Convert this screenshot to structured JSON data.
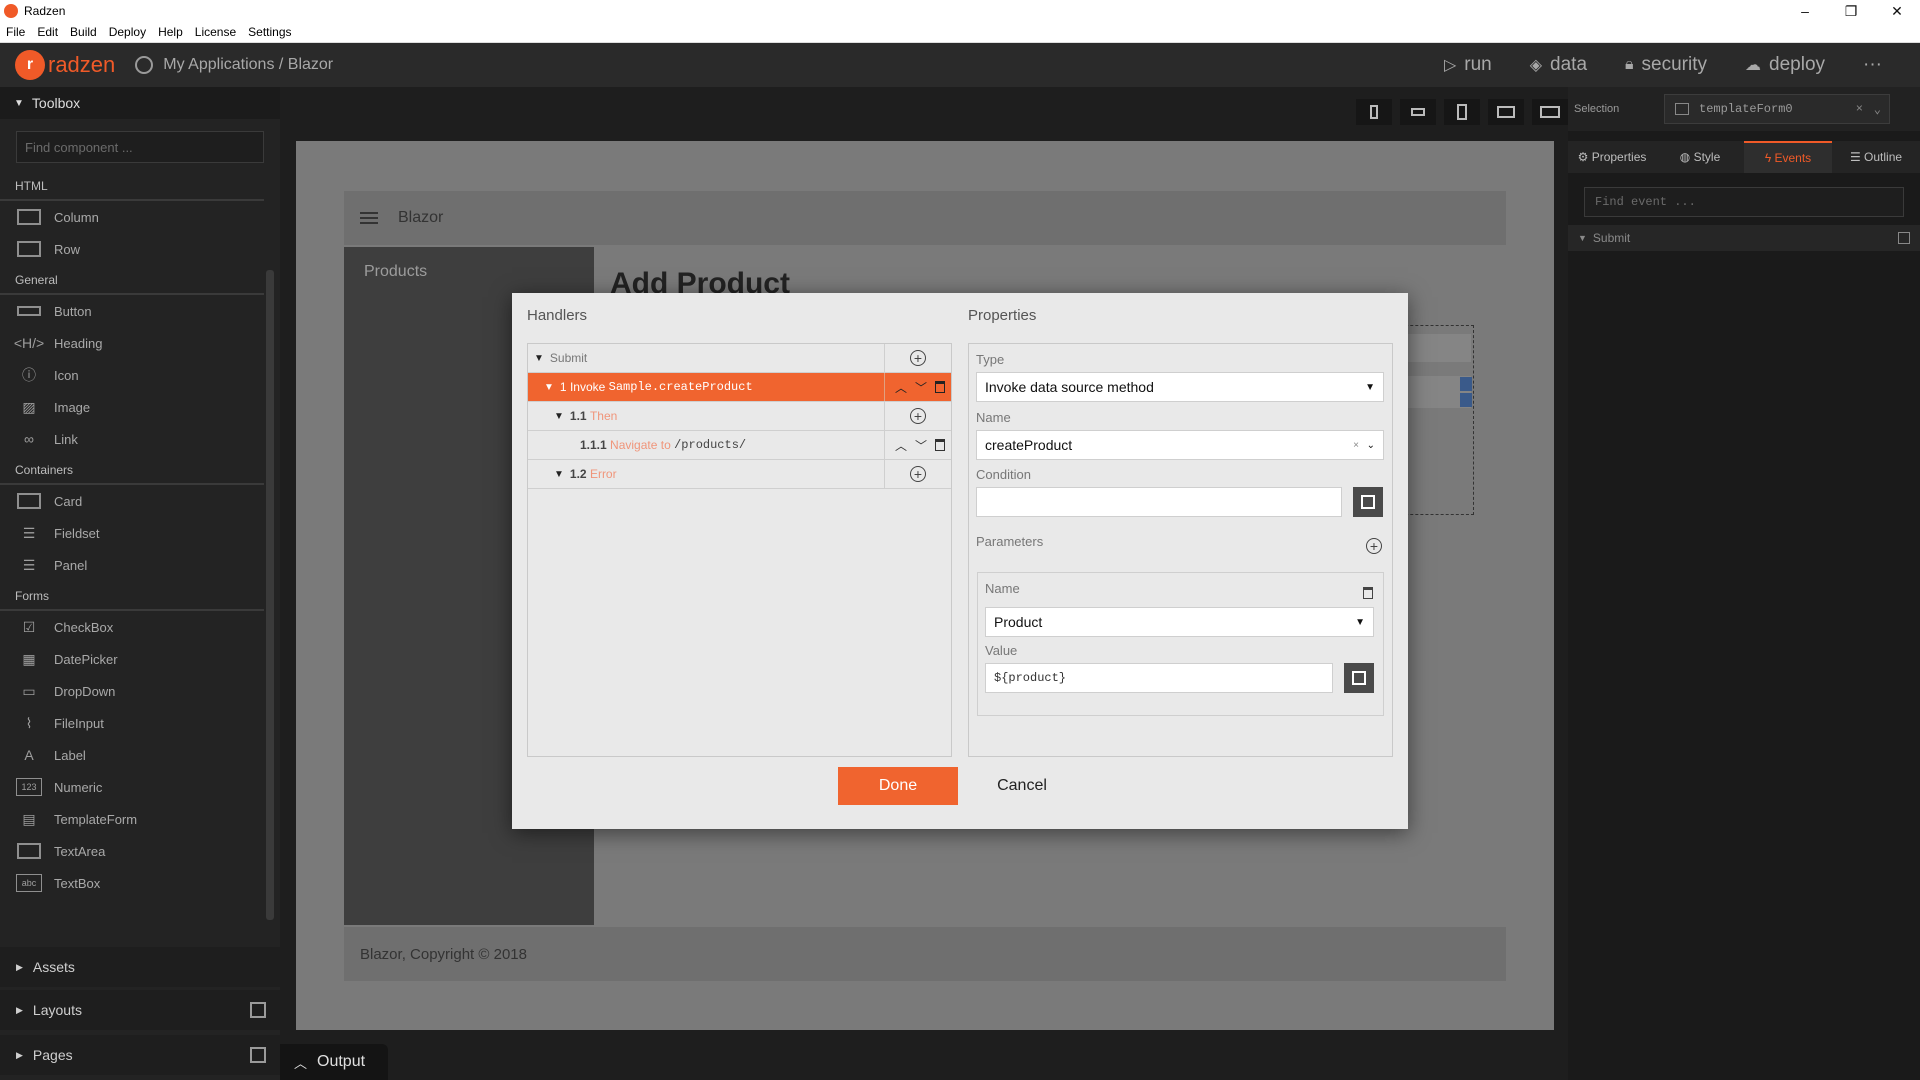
{
  "window": {
    "title": "Radzen",
    "controls": [
      "–",
      "❐",
      "✕"
    ]
  },
  "menu": [
    "File",
    "Edit",
    "Build",
    "Deploy",
    "Help",
    "License",
    "Settings"
  ],
  "header": {
    "logo_text": "radzen",
    "breadcrumb": "My Applications / Blazor",
    "nav": [
      {
        "label": "run",
        "icon": "play-icon"
      },
      {
        "label": "data",
        "icon": "layers-icon"
      },
      {
        "label": "security",
        "icon": "lock-icon"
      },
      {
        "label": "deploy",
        "icon": "cloud-icon"
      }
    ],
    "more": "···"
  },
  "toolbox": {
    "title": "Toolbox",
    "search_placeholder": "Find component ...",
    "sections": [
      {
        "name": "HTML",
        "items": [
          "Column",
          "Row"
        ]
      },
      {
        "name": "General",
        "items": [
          "Button",
          "Heading",
          "Icon",
          "Image",
          "Link"
        ]
      },
      {
        "name": "Containers",
        "items": [
          "Card",
          "Fieldset",
          "Panel"
        ]
      },
      {
        "name": "Forms",
        "items": [
          "CheckBox",
          "DatePicker",
          "DropDown",
          "FileInput",
          "Label",
          "Numeric",
          "TemplateForm",
          "TextArea",
          "TextBox"
        ]
      }
    ],
    "footer": [
      "Assets",
      "Layouts",
      "Pages"
    ]
  },
  "canvas": {
    "app_title": "Blazor",
    "sidebar_link": "Products",
    "page_heading": "Add Product",
    "footer_text": "Blazor, Copyright © 2018"
  },
  "output": {
    "label": "Output"
  },
  "right_panel": {
    "selection_label": "Selection",
    "selection_value": "templateForm0",
    "tabs": [
      "Properties",
      "Style",
      "Events",
      "Outline"
    ],
    "active_tab": "Events",
    "find_placeholder": "Find event ...",
    "event": "Submit"
  },
  "dialog": {
    "handlers_title": "Handlers",
    "properties_title": "Properties",
    "tree": {
      "root": "Submit",
      "n1_num": "1",
      "n1_action": "Invoke",
      "n1_target": "Sample.createProduct",
      "n11_num": "1.1",
      "n11_label": "Then",
      "n111_num": "1.1.1",
      "n111_action": "Navigate to",
      "n111_target": "/products/",
      "n12_num": "1.2",
      "n12_label": "Error"
    },
    "props": {
      "type_label": "Type",
      "type_value": "Invoke data source method",
      "name_label": "Name",
      "name_value": "createProduct",
      "condition_label": "Condition",
      "condition_value": "",
      "parameters_label": "Parameters",
      "param_name_label": "Name",
      "param_name_value": "Product",
      "param_value_label": "Value",
      "param_value": "${product}"
    },
    "done": "Done",
    "cancel": "Cancel"
  },
  "colors": {
    "accent": "#f0642f",
    "dark_bg": "#1e1e1e"
  }
}
